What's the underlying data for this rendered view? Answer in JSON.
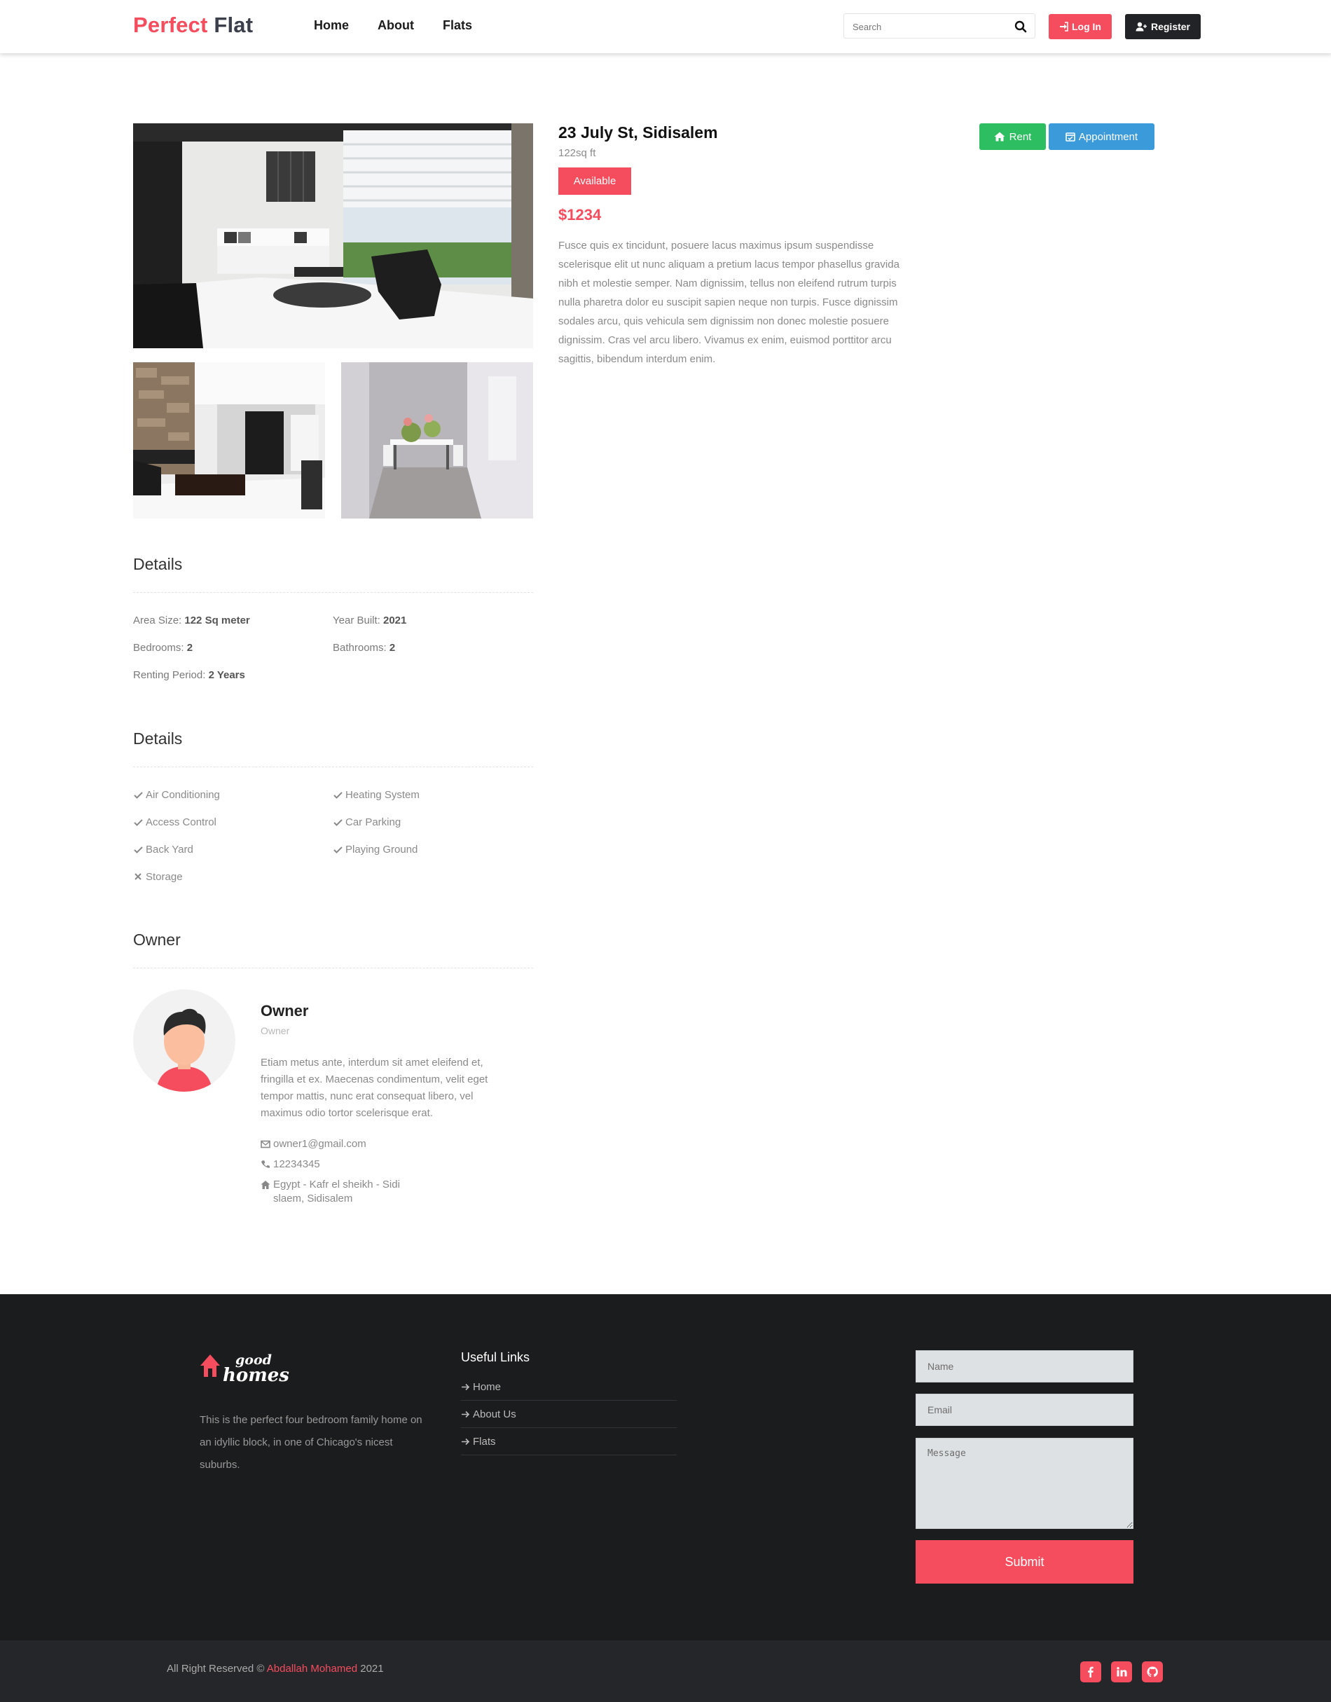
{
  "header": {
    "brand_part1": "Perfect",
    "brand_part2": "Flat",
    "nav": [
      "Home",
      "About",
      "Flats"
    ],
    "search_placeholder": "Search",
    "login_label": "Log In",
    "register_label": "Register"
  },
  "property": {
    "title": "23 July St, Sidisalem",
    "size": "122sq ft",
    "status": "Available",
    "price": "$1234",
    "description": "Fusce quis ex tincidunt, posuere lacus maximus ipsum suspendisse scelerisque elit ut nunc aliquam a pretium lacus tempor phasellus gravida nibh et molestie semper. Nam dignissim, tellus non eleifend rutrum turpis nulla pharetra dolor eu suscipit sapien neque non turpis. Fusce dignissim sodales arcu, quis vehicula sem dignissim non donec molestie posuere dignissim. Cras vel arcu libero. Vivamus ex enim, euismod porttitor arcu sagittis, bibendum interdum enim.",
    "rent_label": "Rent",
    "appointment_label": "Appointment"
  },
  "details": {
    "title": "Details",
    "items": [
      {
        "label": "Area Size:",
        "value": "122 Sq meter"
      },
      {
        "label": "Year Built:",
        "value": "2021"
      },
      {
        "label": "Bedrooms:",
        "value": "2"
      },
      {
        "label": "Bathrooms:",
        "value": "2"
      },
      {
        "label": "Renting Period:",
        "value": "2 Years"
      }
    ]
  },
  "features": {
    "title": "Details",
    "items": [
      {
        "label": "Air Conditioning",
        "available": true
      },
      {
        "label": "Heating System",
        "available": true
      },
      {
        "label": "Access Control",
        "available": true
      },
      {
        "label": "Car Parking",
        "available": true
      },
      {
        "label": "Back Yard",
        "available": true
      },
      {
        "label": "Playing Ground",
        "available": true
      },
      {
        "label": "Storage",
        "available": false
      }
    ]
  },
  "owner": {
    "section_title": "Owner",
    "name": "Owner",
    "role": "Owner",
    "bio": "Etiam metus ante, interdum sit amet eleifend et, fringilla et ex. Maecenas condimentum, velit eget tempor mattis, nunc erat consequat libero, vel maximus odio tortor scelerisque erat.",
    "email": "owner1@gmail.com",
    "phone": "12234345",
    "address": "Egypt - Kafr el sheikh - Sidi slaem, Sidisalem"
  },
  "footer": {
    "logo_text_top": "good",
    "logo_text_bottom": "homes",
    "about": "This is the perfect four bedroom family home on an idyllic block, in one of Chicago's nicest suburbs.",
    "links_title": "Useful Links",
    "links": [
      "Home",
      "About Us",
      "Flats"
    ],
    "form": {
      "name_placeholder": "Name",
      "email_placeholder": "Email",
      "message_placeholder": "Message",
      "submit_label": "Submit"
    },
    "copyright_prefix": "All Right Reserved ©",
    "copyright_name": "Abdallah Mohamed",
    "copyright_year": "2021",
    "social": [
      "facebook-icon",
      "linkedin-icon",
      "github-icon"
    ]
  },
  "colors": {
    "accent": "#f54c5e",
    "dark": "#222326",
    "rent": "#2dbe61",
    "appointment": "#3b9bda",
    "footer_bg": "#1b1c1e"
  }
}
